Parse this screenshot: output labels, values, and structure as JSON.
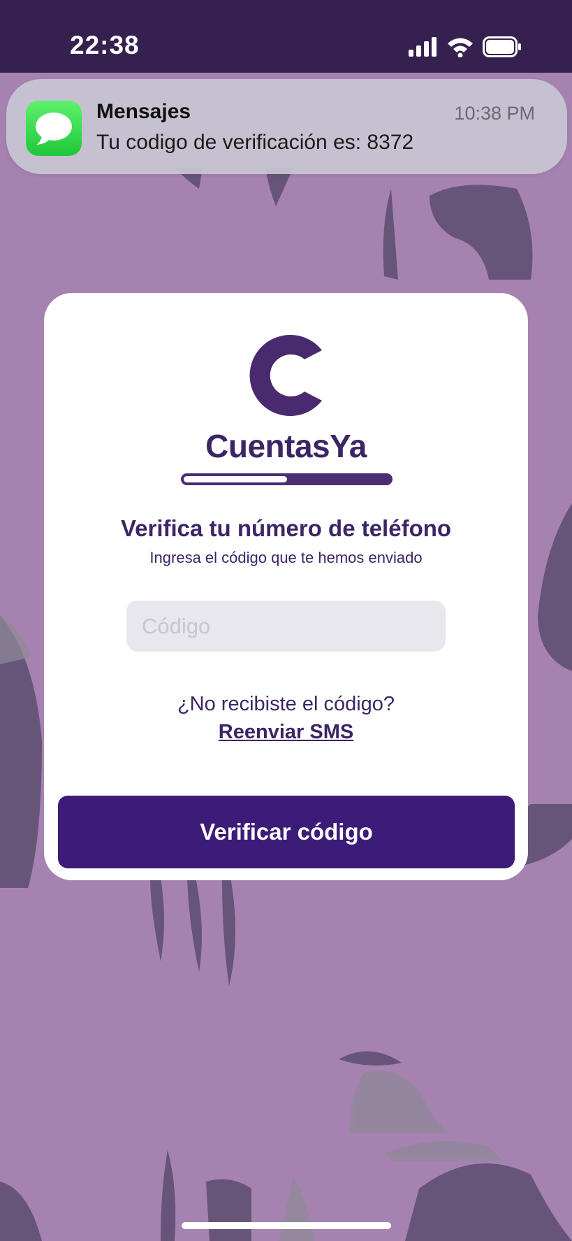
{
  "status_bar": {
    "time": "22:38",
    "icons": [
      "signal-icon",
      "wifi-icon",
      "battery-icon"
    ]
  },
  "notification": {
    "app_name": "Mensajes",
    "time": "10:38 PM",
    "message": "Tu codigo de verificación es: 8372",
    "icon": "messages-app-icon",
    "icon_color": "#2fd34a"
  },
  "card": {
    "brand_name": "CuentasYa",
    "progress_fraction": 0.5,
    "title": "Verifica tu número de teléfono",
    "subtitle": "Ingresa el código que te hemos enviado",
    "code_input": {
      "value": "",
      "placeholder": "Código"
    },
    "resend_question": "¿No recibiste el código?",
    "resend_link": "Reenviar SMS",
    "verify_button": "Verificar código"
  },
  "colors": {
    "brand": "#3c2566",
    "button": "#3d1b78",
    "background": "#a682b1",
    "status_bar": "#352050"
  }
}
